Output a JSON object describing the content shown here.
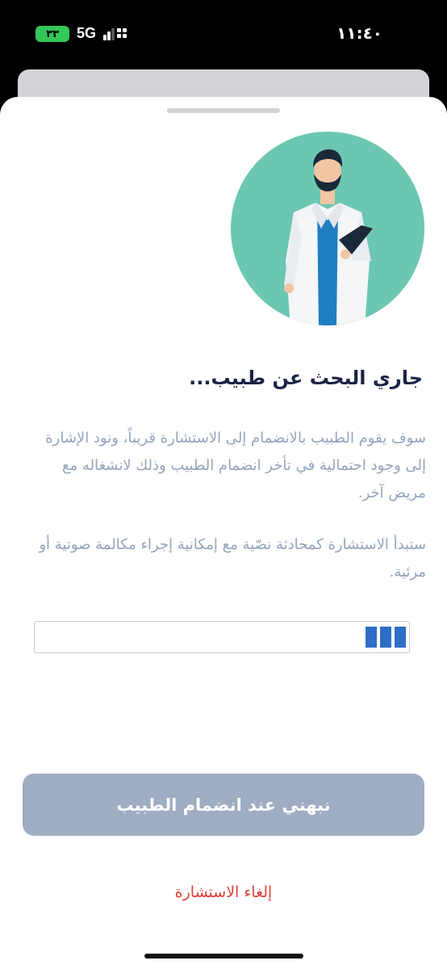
{
  "status_bar": {
    "battery": "٣٣",
    "network": "5G",
    "time": "١١:٤٠"
  },
  "content": {
    "title": "جاري البحث عن طبيب...",
    "paragraph_1": "سوف يقوم الطبيب بالانضمام إلى الاستشارة قريباً، ونود الإشارة إلى وجود احتمالية في تأخر انضمام الطبيب وذلك لانشغاله مع مريض آخر.",
    "paragraph_2": "ستبدأ الاستشارة كمحادثة نصّية مع إمكانية إجراء مكالمة صوتية أو مرئية."
  },
  "progress": {
    "filled_segments": 3
  },
  "actions": {
    "notify_button": "نبهني عند انضمام الطبيب",
    "cancel_link": "إلغاء الاستشارة"
  },
  "colors": {
    "illustration_circle": "#6cc7b0",
    "title": "#1b2445",
    "body_text": "#94a3bd",
    "progress_fill": "#2f6ec8",
    "button_bg": "#9fadc3",
    "cancel_text": "#e0403a"
  }
}
